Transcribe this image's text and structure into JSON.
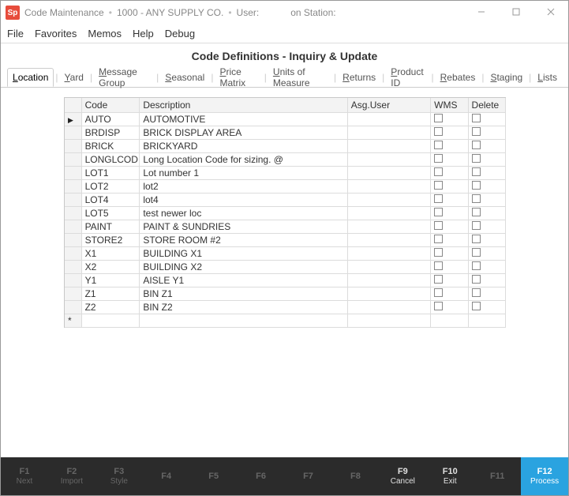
{
  "titlebar": {
    "app_short": "Sp",
    "app_name": "Code Maintenance",
    "company": "1000 - ANY SUPPLY CO.",
    "user_label": "User:",
    "station_label": "on Station:"
  },
  "menu": {
    "file": "File",
    "favorites": "Favorites",
    "memos": "Memos",
    "help": "Help",
    "debug": "Debug"
  },
  "heading": "Code Definitions - Inquiry & Update",
  "tabs": [
    "Location",
    "Yard",
    "Message Group",
    "Seasonal",
    "Price Matrix",
    "Units of Measure",
    "Returns",
    "Product ID",
    "Rebates",
    "Staging",
    "Lists"
  ],
  "active_tab_index": 0,
  "columns": {
    "code": "Code",
    "description": "Description",
    "asg_user": "Asg.User",
    "wms": "WMS",
    "delete": "Delete"
  },
  "rows": [
    {
      "ptr": true,
      "code": "AUTO",
      "desc": "AUTOMOTIVE",
      "asg": "",
      "wms": false,
      "del": false
    },
    {
      "ptr": false,
      "code": "BRDISP",
      "desc": "BRICK DISPLAY AREA",
      "asg": "",
      "wms": false,
      "del": false
    },
    {
      "ptr": false,
      "code": "BRICK",
      "desc": "BRICKYARD",
      "asg": "",
      "wms": false,
      "del": false
    },
    {
      "ptr": false,
      "code": "LONGLCOD",
      "desc": "Long Location Code for sizing. @",
      "asg": "",
      "wms": false,
      "del": false
    },
    {
      "ptr": false,
      "code": "LOT1",
      "desc": "Lot number 1",
      "asg": "",
      "wms": false,
      "del": false
    },
    {
      "ptr": false,
      "code": "LOT2",
      "desc": "lot2",
      "asg": "",
      "wms": false,
      "del": false
    },
    {
      "ptr": false,
      "code": "LOT4",
      "desc": "lot4",
      "asg": "",
      "wms": false,
      "del": false
    },
    {
      "ptr": false,
      "code": "LOT5",
      "desc": "test newer loc",
      "asg": "",
      "wms": false,
      "del": false
    },
    {
      "ptr": false,
      "code": "PAINT",
      "desc": "PAINT & SUNDRIES",
      "asg": "",
      "wms": false,
      "del": false
    },
    {
      "ptr": false,
      "code": "STORE2",
      "desc": "STORE ROOM #2",
      "asg": "",
      "wms": false,
      "del": false
    },
    {
      "ptr": false,
      "code": "X1",
      "desc": "BUILDING X1",
      "asg": "",
      "wms": false,
      "del": false
    },
    {
      "ptr": false,
      "code": "X2",
      "desc": "BUILDING X2",
      "asg": "",
      "wms": false,
      "del": false
    },
    {
      "ptr": false,
      "code": "Y1",
      "desc": "AISLE Y1",
      "asg": "",
      "wms": false,
      "del": false
    },
    {
      "ptr": false,
      "code": "Z1",
      "desc": "BIN Z1",
      "asg": "",
      "wms": false,
      "del": false
    },
    {
      "ptr": false,
      "code": "Z2",
      "desc": "BIN Z2",
      "asg": "",
      "wms": false,
      "del": false
    }
  ],
  "fkeys": [
    {
      "key": "F1",
      "label": "Next",
      "state": "dim"
    },
    {
      "key": "F2",
      "label": "Import",
      "state": "dim"
    },
    {
      "key": "F3",
      "label": "Style",
      "state": "dim"
    },
    {
      "key": "F4",
      "label": "",
      "state": "dim"
    },
    {
      "key": "F5",
      "label": "",
      "state": "dim"
    },
    {
      "key": "F6",
      "label": "",
      "state": "dim"
    },
    {
      "key": "F7",
      "label": "",
      "state": "dim"
    },
    {
      "key": "F8",
      "label": "",
      "state": "dim"
    },
    {
      "key": "F9",
      "label": "Cancel",
      "state": "bright"
    },
    {
      "key": "F10",
      "label": "Exit",
      "state": "bright"
    },
    {
      "key": "F11",
      "label": "",
      "state": "dim"
    },
    {
      "key": "F12",
      "label": "Process",
      "state": "primary"
    }
  ]
}
